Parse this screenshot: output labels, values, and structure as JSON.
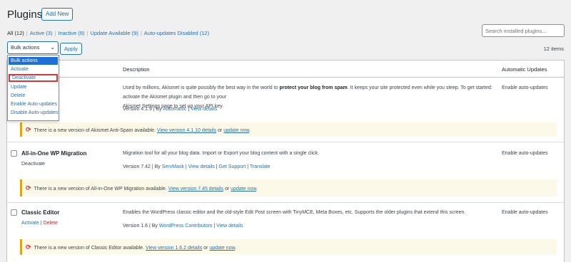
{
  "header": {
    "title": "Plugins",
    "add_new": "Add New"
  },
  "filters": {
    "all": "All (12)",
    "active": "Active (3)",
    "inactive": "Inactive (9)",
    "update_available": "Update Available (9)",
    "auto_updates_disabled": "Auto-updates Disabled (12)",
    "separator": "|"
  },
  "search": {
    "placeholder": "Search installed plugins..."
  },
  "bulk": {
    "selected": "Bulk actions",
    "apply": "Apply",
    "options": [
      "Bulk actions",
      "Activate",
      "Deactivate",
      "Update",
      "Delete",
      "Enable Auto-updates",
      "Disable Auto-updates"
    ]
  },
  "count": "12 items",
  "table": {
    "col_description": "Description",
    "col_auto": "Automatic Updates"
  },
  "plugins": [
    {
      "desc_pre": "Used by millions, Akismet is quite possibly the best way in the world to ",
      "desc_bold": "protect your blog from spam",
      "desc_post": ". It keeps your site protected even while you sleep. To get started: activate the Akismet plugin and then go to your",
      "desc_line2": "Akismet Settings page to set up your API key.",
      "version_pre": "Version 4.1.9 | By ",
      "author": "Automattic",
      "sep": " | ",
      "view_details": "View details",
      "auto": "Enable auto-updates",
      "notice_pre": "There is a new version of Akismet Anti-Spam available. ",
      "notice_link": "View version 4.1.10 details",
      "notice_or": " or ",
      "notice_update": "update now",
      "notice_end": "."
    },
    {
      "name": "All-in-One WP Migration",
      "action1": "Deactivate",
      "desc": "Migration tool for all your blog data. Import or Export your blog content with a single click.",
      "version_pre": "Version 7.42 | By ",
      "author": "ServMask",
      "sep": " | ",
      "view_details": "View details",
      "get_support": "Get Support",
      "translate": "Translate",
      "auto": "Enable auto-updates",
      "notice_pre": "There is a new version of All-in-One WP Migration available. ",
      "notice_link": "View version 7.45 details",
      "notice_or": " or ",
      "notice_update": "update now",
      "notice_end": "."
    },
    {
      "name": "Classic Editor",
      "action1": "Activate",
      "action_sep": " | ",
      "action2": "Delete",
      "desc": "Enables the WordPress classic editor and the old-style Edit Post screen with TinyMCE, Meta Boxes, etc. Supports the older plugins that extend this screen.",
      "version_pre": "Version 1.6 | By ",
      "author": "WordPress Contributors",
      "sep": " | ",
      "view_details": "View details",
      "auto": "Enable auto-updates",
      "notice_pre": "There is a new version of Classic Editor available. ",
      "notice_link": "View version 1.6.2 details",
      "notice_or": " or ",
      "notice_update": "update now",
      "notice_end": "."
    }
  ]
}
